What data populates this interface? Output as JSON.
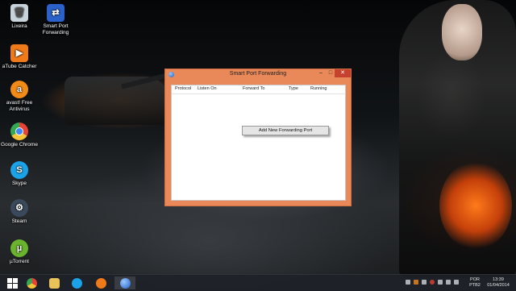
{
  "desktop": {
    "icons": [
      {
        "label": "Lixeira",
        "icon": "recycle-bin-icon",
        "color": "#c9d3db"
      },
      {
        "label": "Smart Port Forwarding",
        "icon": "smart-port-forwarding-icon",
        "color": "#2a62c9"
      },
      {
        "label": "aTube Catcher",
        "icon": "atube-catcher-icon",
        "color": "#f07a1a"
      },
      {
        "label": "avast! Free Antivirus",
        "icon": "avast-icon",
        "color": "#f28a18"
      },
      {
        "label": "Google Chrome",
        "icon": "chrome-icon",
        "color": "#e54335"
      },
      {
        "label": "Skype",
        "icon": "skype-icon",
        "color": "#1aa3e8"
      },
      {
        "label": "Steam",
        "icon": "steam-icon",
        "color": "#3a4a5c"
      },
      {
        "label": "µTorrent",
        "icon": "utorrent-icon",
        "color": "#69b32d"
      }
    ]
  },
  "window": {
    "title": "Smart Port Forwarding",
    "buttons": {
      "minimize": "–",
      "maximize": "□",
      "close": "✕"
    },
    "columns": [
      "Protocol",
      "Listen On",
      "Forward To",
      "Type",
      "Running"
    ],
    "add_button_label": "Add New Forwarding Port",
    "accent": "#e9895a"
  },
  "taskbar": {
    "apps": [
      {
        "name": "start",
        "icon": "windows-start-icon"
      },
      {
        "name": "chrome",
        "icon": "chrome-icon",
        "color": "#e54335"
      },
      {
        "name": "explorer",
        "icon": "folder-icon",
        "color": "#e9c35a"
      },
      {
        "name": "skype",
        "icon": "skype-icon",
        "color": "#1aa3e8"
      },
      {
        "name": "atube",
        "icon": "atube-catcher-icon",
        "color": "#f07a1a"
      },
      {
        "name": "smart-port-forwarding",
        "icon": "smart-port-forwarding-icon",
        "color": "#2a62c9"
      }
    ],
    "language": "POR",
    "keyboard": "PTB2",
    "time": "13:39",
    "date": "01/04/2014"
  }
}
